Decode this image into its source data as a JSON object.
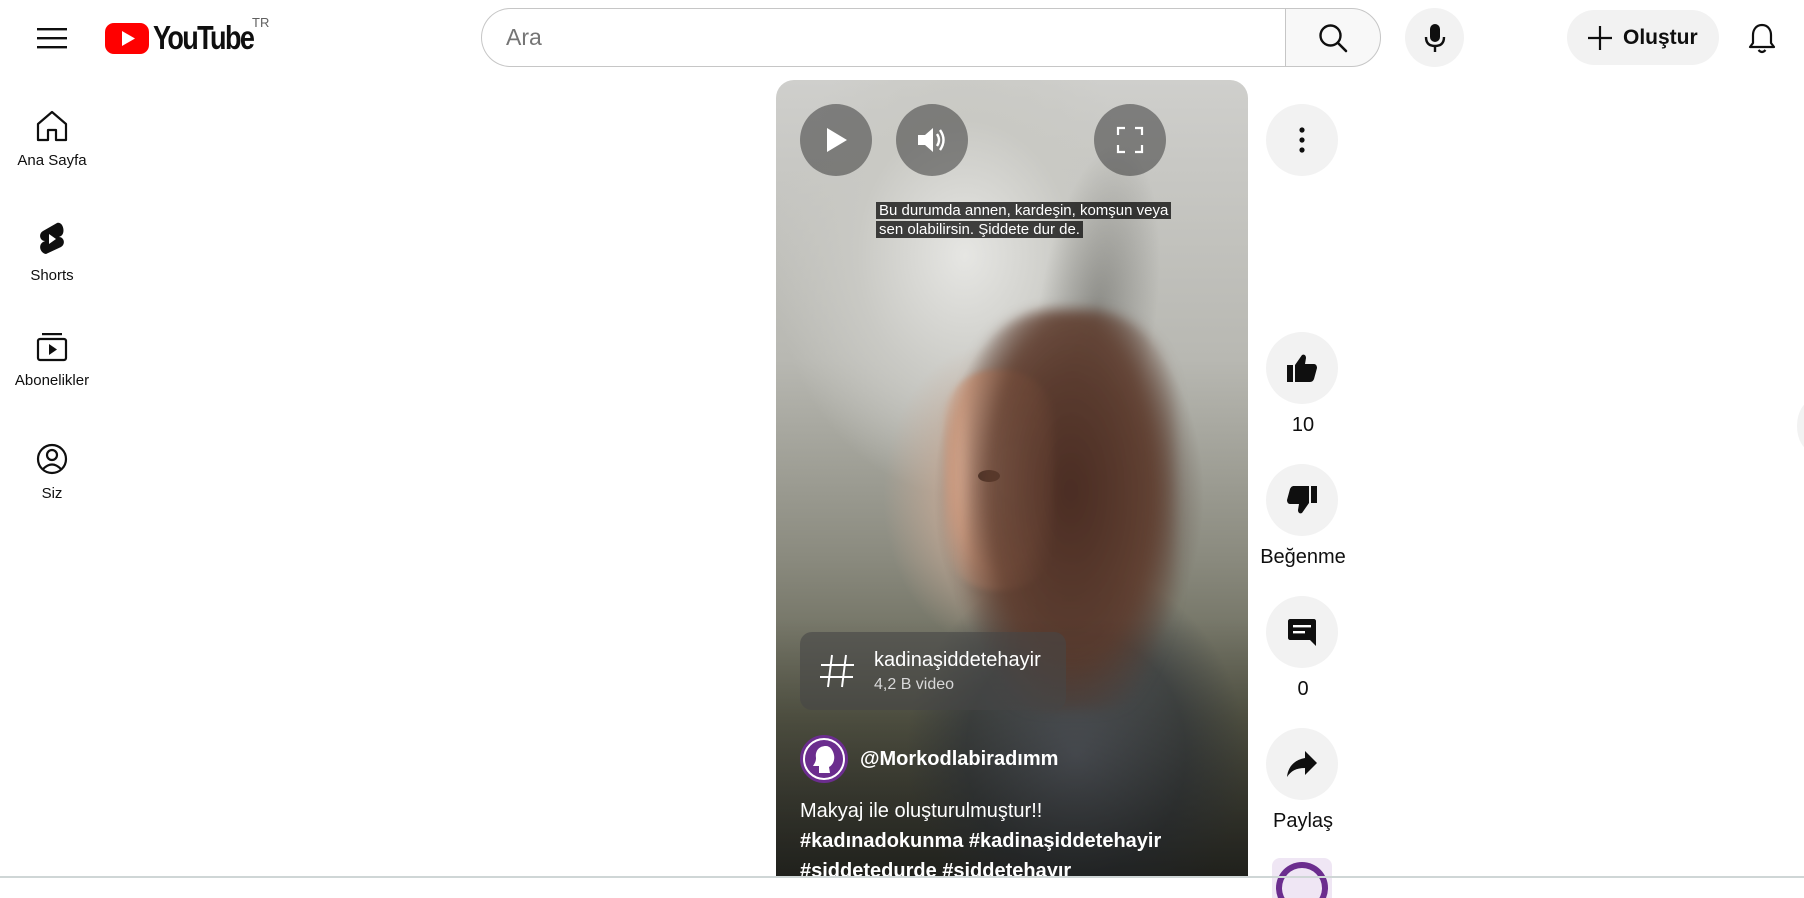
{
  "header": {
    "logo_text": "YouTube",
    "country_code": "TR",
    "search_placeholder": "Ara",
    "create_label": "Oluştur"
  },
  "sidebar": {
    "items": [
      {
        "label": "Ana Sayfa",
        "icon": "home-icon"
      },
      {
        "label": "Shorts",
        "icon": "shorts-icon"
      },
      {
        "label": "Abonelikler",
        "icon": "subscriptions-icon"
      },
      {
        "label": "Siz",
        "icon": "account-icon"
      }
    ]
  },
  "player": {
    "caption_line1": "Bu durumda annen, kardeşin, komşun veya",
    "caption_line2": "sen olabilirsin. Şiddete dur de.",
    "hashtag": "kadinaşiddetehayir",
    "hashtag_count": "4,2 B video",
    "channel_name": "@Morkodlabiradımm",
    "description": "Makyaj ile oluşturulmuştur!!",
    "description_tags_line1": "#kadınadokunma #kadinaşiddetehayir",
    "description_tags_line2": "#şiddetedurde #şiddetehayır"
  },
  "actions": {
    "like_count": "10",
    "dislike_label": "Beğenme",
    "comment_count": "0",
    "share_label": "Paylaş"
  },
  "colors": {
    "brand_red": "#ff0000",
    "channel_purple": "#6b2d8e"
  }
}
